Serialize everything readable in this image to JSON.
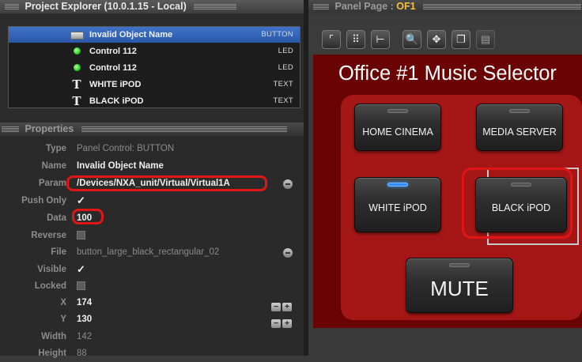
{
  "project_explorer": {
    "title": "Project Explorer (10.0.1.15 - Local)",
    "items": [
      {
        "icon": "button-icon",
        "name": "Invalid Object Name",
        "type": "BUTTON",
        "selected": true
      },
      {
        "icon": "led-icon",
        "name": "Control 112",
        "type": "LED"
      },
      {
        "icon": "led-icon",
        "name": "Control 112",
        "type": "LED"
      },
      {
        "icon": "text-icon",
        "name": "WHITE iPOD",
        "type": "TEXT"
      },
      {
        "icon": "text-icon",
        "name": "BLACK iPOD",
        "type": "TEXT"
      }
    ]
  },
  "properties": {
    "title": "Properties",
    "type_label": "Type",
    "type_value": "Panel Control: BUTTON",
    "name_label": "Name",
    "name_value": "Invalid Object Name",
    "param_label": "Param",
    "param_value": "/Devices/NXA_unit/Virtual/Virtual1A",
    "push_only_label": "Push Only",
    "data_label": "Data",
    "data_value": "100",
    "reverse_label": "Reverse",
    "file_label": "File",
    "file_value": "button_large_black_rectangular_02",
    "visible_label": "Visible",
    "locked_label": "Locked",
    "x_label": "X",
    "x_value": "174",
    "y_label": "Y",
    "y_value": "130",
    "width_label": "Width",
    "width_value": "142",
    "height_label": "Height",
    "height_value": "88"
  },
  "panel_page": {
    "title_prefix": "Panel Page : ",
    "page_name": "OF1",
    "canvas_title": "Office #1 Music Selector",
    "buttons": {
      "home_cinema": "HOME CINEMA",
      "media_server": "MEDIA SERVER",
      "white_ipod": "WHITE iPOD",
      "black_ipod": "BLACK iPOD",
      "mute": "MUTE"
    },
    "toolbar_icons": [
      "frame-icon",
      "grid-icon",
      "align-icon",
      "zoom-icon",
      "move-icon",
      "copy-icon",
      "paste-icon"
    ]
  },
  "colors": {
    "accent_selection": "#2a58a8",
    "annotation_red": "#e01616",
    "canvas_bg": "#6a0303",
    "panel_bg": "#a51717",
    "page_name": "#f3c23c"
  }
}
